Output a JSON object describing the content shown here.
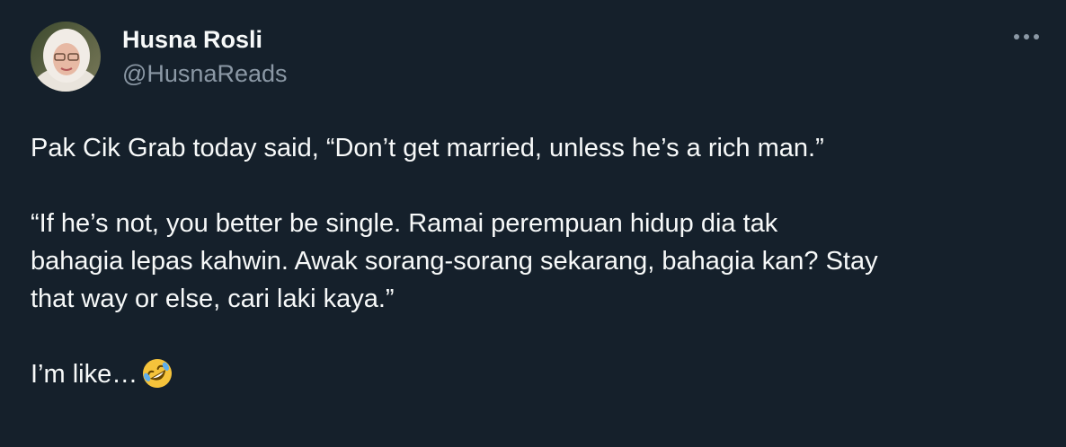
{
  "author": {
    "name": "Husna Rosli",
    "handle": "@HusnaReads"
  },
  "menu": {
    "icon": "more-horizontal-icon"
  },
  "tweet": {
    "line_1": "Pak Cik Grab today said, “Don’t get married, unless he’s a rich man.”",
    "line_2": "“If he’s not, you better be single. Ramai perempuan hidup dia tak",
    "line_3": "bahagia lepas kahwin. Awak sorang-sorang sekarang, bahagia kan? Stay",
    "line_4": "that way or else, cari laki kaya.”",
    "line_5": "I’m like…",
    "emoji": "rolling-on-the-floor-laughing-emoji"
  },
  "colors": {
    "background": "#15202b",
    "primary_text": "#f7f9f9",
    "secondary_text": "#8b98a5",
    "emoji_yellow": "#f5c33b"
  }
}
